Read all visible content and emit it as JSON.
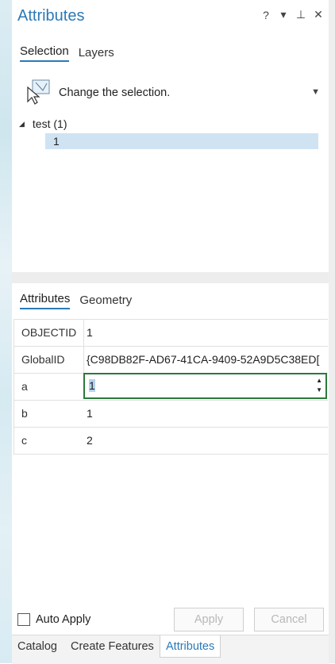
{
  "window": {
    "title": "Attributes"
  },
  "title_controls": {
    "help": "?",
    "menu": "▾",
    "pin": "⊥",
    "close": "✕"
  },
  "top_tabs": [
    {
      "label": "Selection",
      "active": true
    },
    {
      "label": "Layers",
      "active": false
    }
  ],
  "selection": {
    "action_label": "Change the selection."
  },
  "tree": {
    "layer_label": "test (1)",
    "items": [
      "1"
    ]
  },
  "bottom_tabs": [
    {
      "label": "Attributes",
      "active": true
    },
    {
      "label": "Geometry",
      "active": false
    }
  ],
  "fields": [
    {
      "name": "OBJECTID",
      "value": "1"
    },
    {
      "name": "GlobalID",
      "value": "{C98DB82F-AD67-41CA-9409-52A9D5C38ED["
    },
    {
      "name": "a",
      "value": "1",
      "editing": true
    },
    {
      "name": "b",
      "value": "1"
    },
    {
      "name": "c",
      "value": "2"
    }
  ],
  "actions": {
    "auto_apply_label": "Auto Apply",
    "auto_apply_checked": false,
    "apply_label": "Apply",
    "cancel_label": "Cancel"
  },
  "footer_tabs": [
    {
      "label": "Catalog",
      "active": false
    },
    {
      "label": "Create Features",
      "active": false
    },
    {
      "label": "Attributes",
      "active": true
    }
  ],
  "colors": {
    "accent": "#2b79b8",
    "edit_border": "#2a7a3b",
    "selection_bg": "#cfe3f3"
  }
}
